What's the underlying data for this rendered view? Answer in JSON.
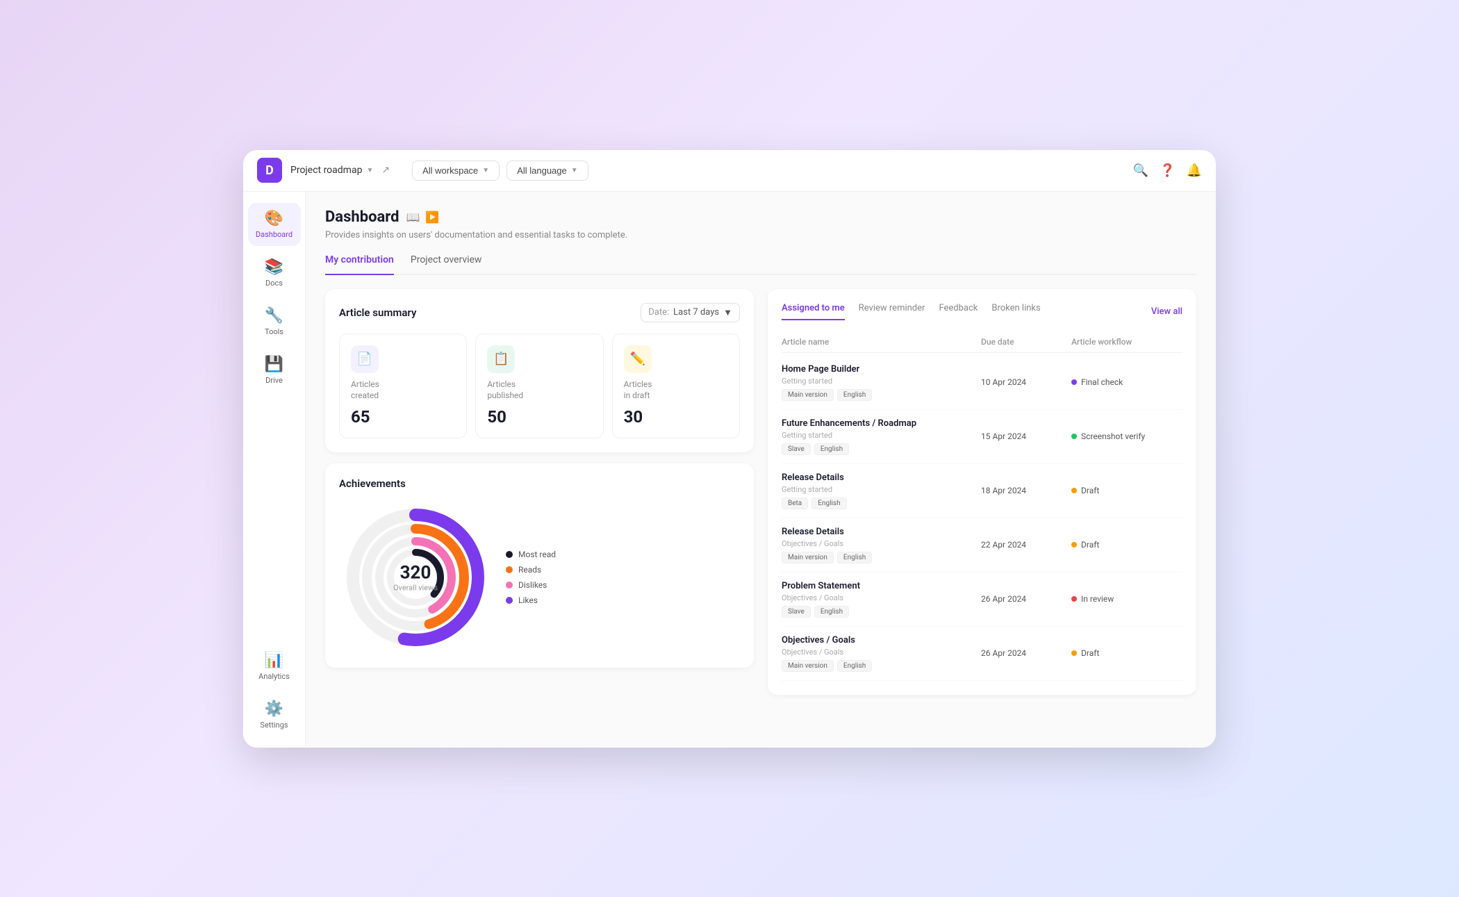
{
  "topBar": {
    "project": "Project roadmap",
    "filters": [
      {
        "label": "All workspace",
        "id": "workspace"
      },
      {
        "label": "All language",
        "id": "language"
      }
    ],
    "icons": [
      "search",
      "help",
      "notification"
    ]
  },
  "sidebar": {
    "items": [
      {
        "id": "dashboard",
        "label": "Dashboard",
        "icon": "🎨",
        "active": true
      },
      {
        "id": "docs",
        "label": "Docs",
        "icon": "📚",
        "active": false
      },
      {
        "id": "tools",
        "label": "Tools",
        "icon": "🔧",
        "active": false
      },
      {
        "id": "drive",
        "label": "Drive",
        "icon": "💾",
        "active": false
      },
      {
        "id": "analytics",
        "label": "Analytics",
        "icon": "📊",
        "active": false
      },
      {
        "id": "settings",
        "label": "Settings",
        "icon": "⚙️",
        "active": false
      }
    ]
  },
  "dashboard": {
    "title": "Dashboard",
    "subtitle": "Provides insights on users' documentation and essential tasks to complete.",
    "tabs": [
      {
        "id": "my-contribution",
        "label": "My contribution",
        "active": true
      },
      {
        "id": "project-overview",
        "label": "Project overview",
        "active": false
      }
    ]
  },
  "articleSummary": {
    "title": "Article summary",
    "dateFilter": {
      "label": "Date:",
      "value": "Last 7 days"
    },
    "stats": [
      {
        "id": "created",
        "icon": "📄",
        "iconBg": "purple",
        "label": "Articles\ncreated",
        "value": "65"
      },
      {
        "id": "published",
        "icon": "📋",
        "iconBg": "green",
        "label": "Articles\npublished",
        "value": "50"
      },
      {
        "id": "draft",
        "icon": "✏️",
        "iconBg": "yellow",
        "label": "Articles\nin draft",
        "value": "30"
      }
    ]
  },
  "achievements": {
    "title": "Achievements",
    "overallValue": "320",
    "overallLabel": "Overall views",
    "legend": [
      {
        "label": "Most read",
        "color": "#1a1a2e"
      },
      {
        "label": "Reads",
        "color": "#f97316"
      },
      {
        "label": "Dislikes",
        "color": "#f472b6"
      },
      {
        "label": "Likes",
        "color": "#7c3aed"
      }
    ]
  },
  "assignedTable": {
    "tabs": [
      {
        "id": "assigned",
        "label": "Assigned to me",
        "active": true
      },
      {
        "id": "review",
        "label": "Review reminder",
        "active": false
      },
      {
        "id": "feedback",
        "label": "Feedback",
        "active": false
      },
      {
        "id": "broken",
        "label": "Broken links",
        "active": false
      }
    ],
    "viewAllLabel": "View all",
    "columns": [
      "Article name",
      "Due date",
      "Article workflow"
    ],
    "rows": [
      {
        "name": "Home Page Builder",
        "category": "Getting started",
        "tags": [
          "Main version",
          "English"
        ],
        "dueDate": "10 Apr 2024",
        "workflow": "Final check",
        "workflowColor": "purple"
      },
      {
        "name": "Future Enhancements / Roadmap",
        "category": "Getting started",
        "tags": [
          "Slave",
          "English"
        ],
        "dueDate": "15 Apr 2024",
        "workflow": "Screenshot verify",
        "workflowColor": "green"
      },
      {
        "name": "Release Details",
        "category": "Getting started",
        "tags": [
          "Beta",
          "English"
        ],
        "dueDate": "18 Apr 2024",
        "workflow": "Draft",
        "workflowColor": "yellow"
      },
      {
        "name": "Release Details",
        "category": "Objectives / Goals",
        "tags": [
          "Main version",
          "English"
        ],
        "dueDate": "22 Apr 2024",
        "workflow": "Draft",
        "workflowColor": "yellow"
      },
      {
        "name": "Problem Statement",
        "category": "Objectives / Goals",
        "tags": [
          "Slave",
          "English"
        ],
        "dueDate": "26 Apr 2024",
        "workflow": "In review",
        "workflowColor": "red"
      },
      {
        "name": "Objectives / Goals",
        "category": "Objectives / Goals",
        "tags": [
          "Main version",
          "English"
        ],
        "dueDate": "26 Apr 2024",
        "workflow": "Draft",
        "workflowColor": "yellow"
      }
    ]
  }
}
